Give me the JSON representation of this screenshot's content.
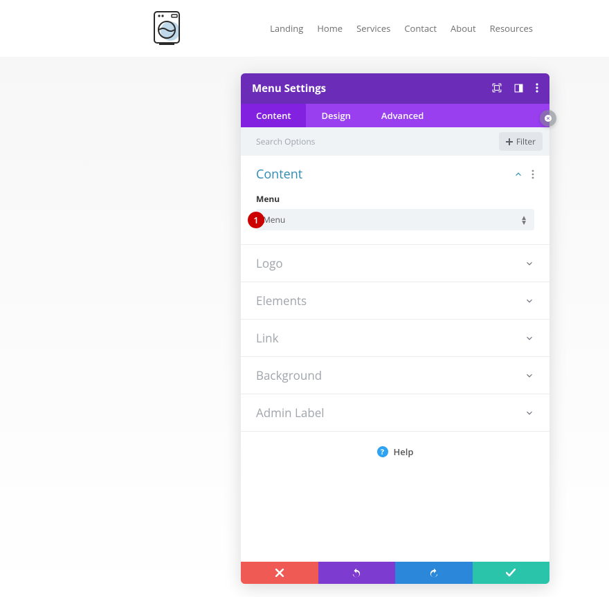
{
  "site": {
    "nav": [
      {
        "label": "Landing"
      },
      {
        "label": "Home"
      },
      {
        "label": "Services"
      },
      {
        "label": "Contact"
      },
      {
        "label": "About"
      },
      {
        "label": "Resources"
      }
    ]
  },
  "modal": {
    "title": "Menu Settings",
    "tabs": {
      "content": "Content",
      "design": "Design",
      "advanced": "Advanced"
    },
    "search_placeholder": "Search Options",
    "filter_label": "Filter",
    "sections": {
      "content": {
        "title": "Content",
        "menu_label": "Menu",
        "menu_value": "Menu",
        "badge": "1"
      },
      "logo": {
        "title": "Logo"
      },
      "elements": {
        "title": "Elements"
      },
      "link": {
        "title": "Link"
      },
      "background": {
        "title": "Background"
      },
      "admin_label": {
        "title": "Admin Label"
      }
    },
    "help_label": "Help"
  }
}
